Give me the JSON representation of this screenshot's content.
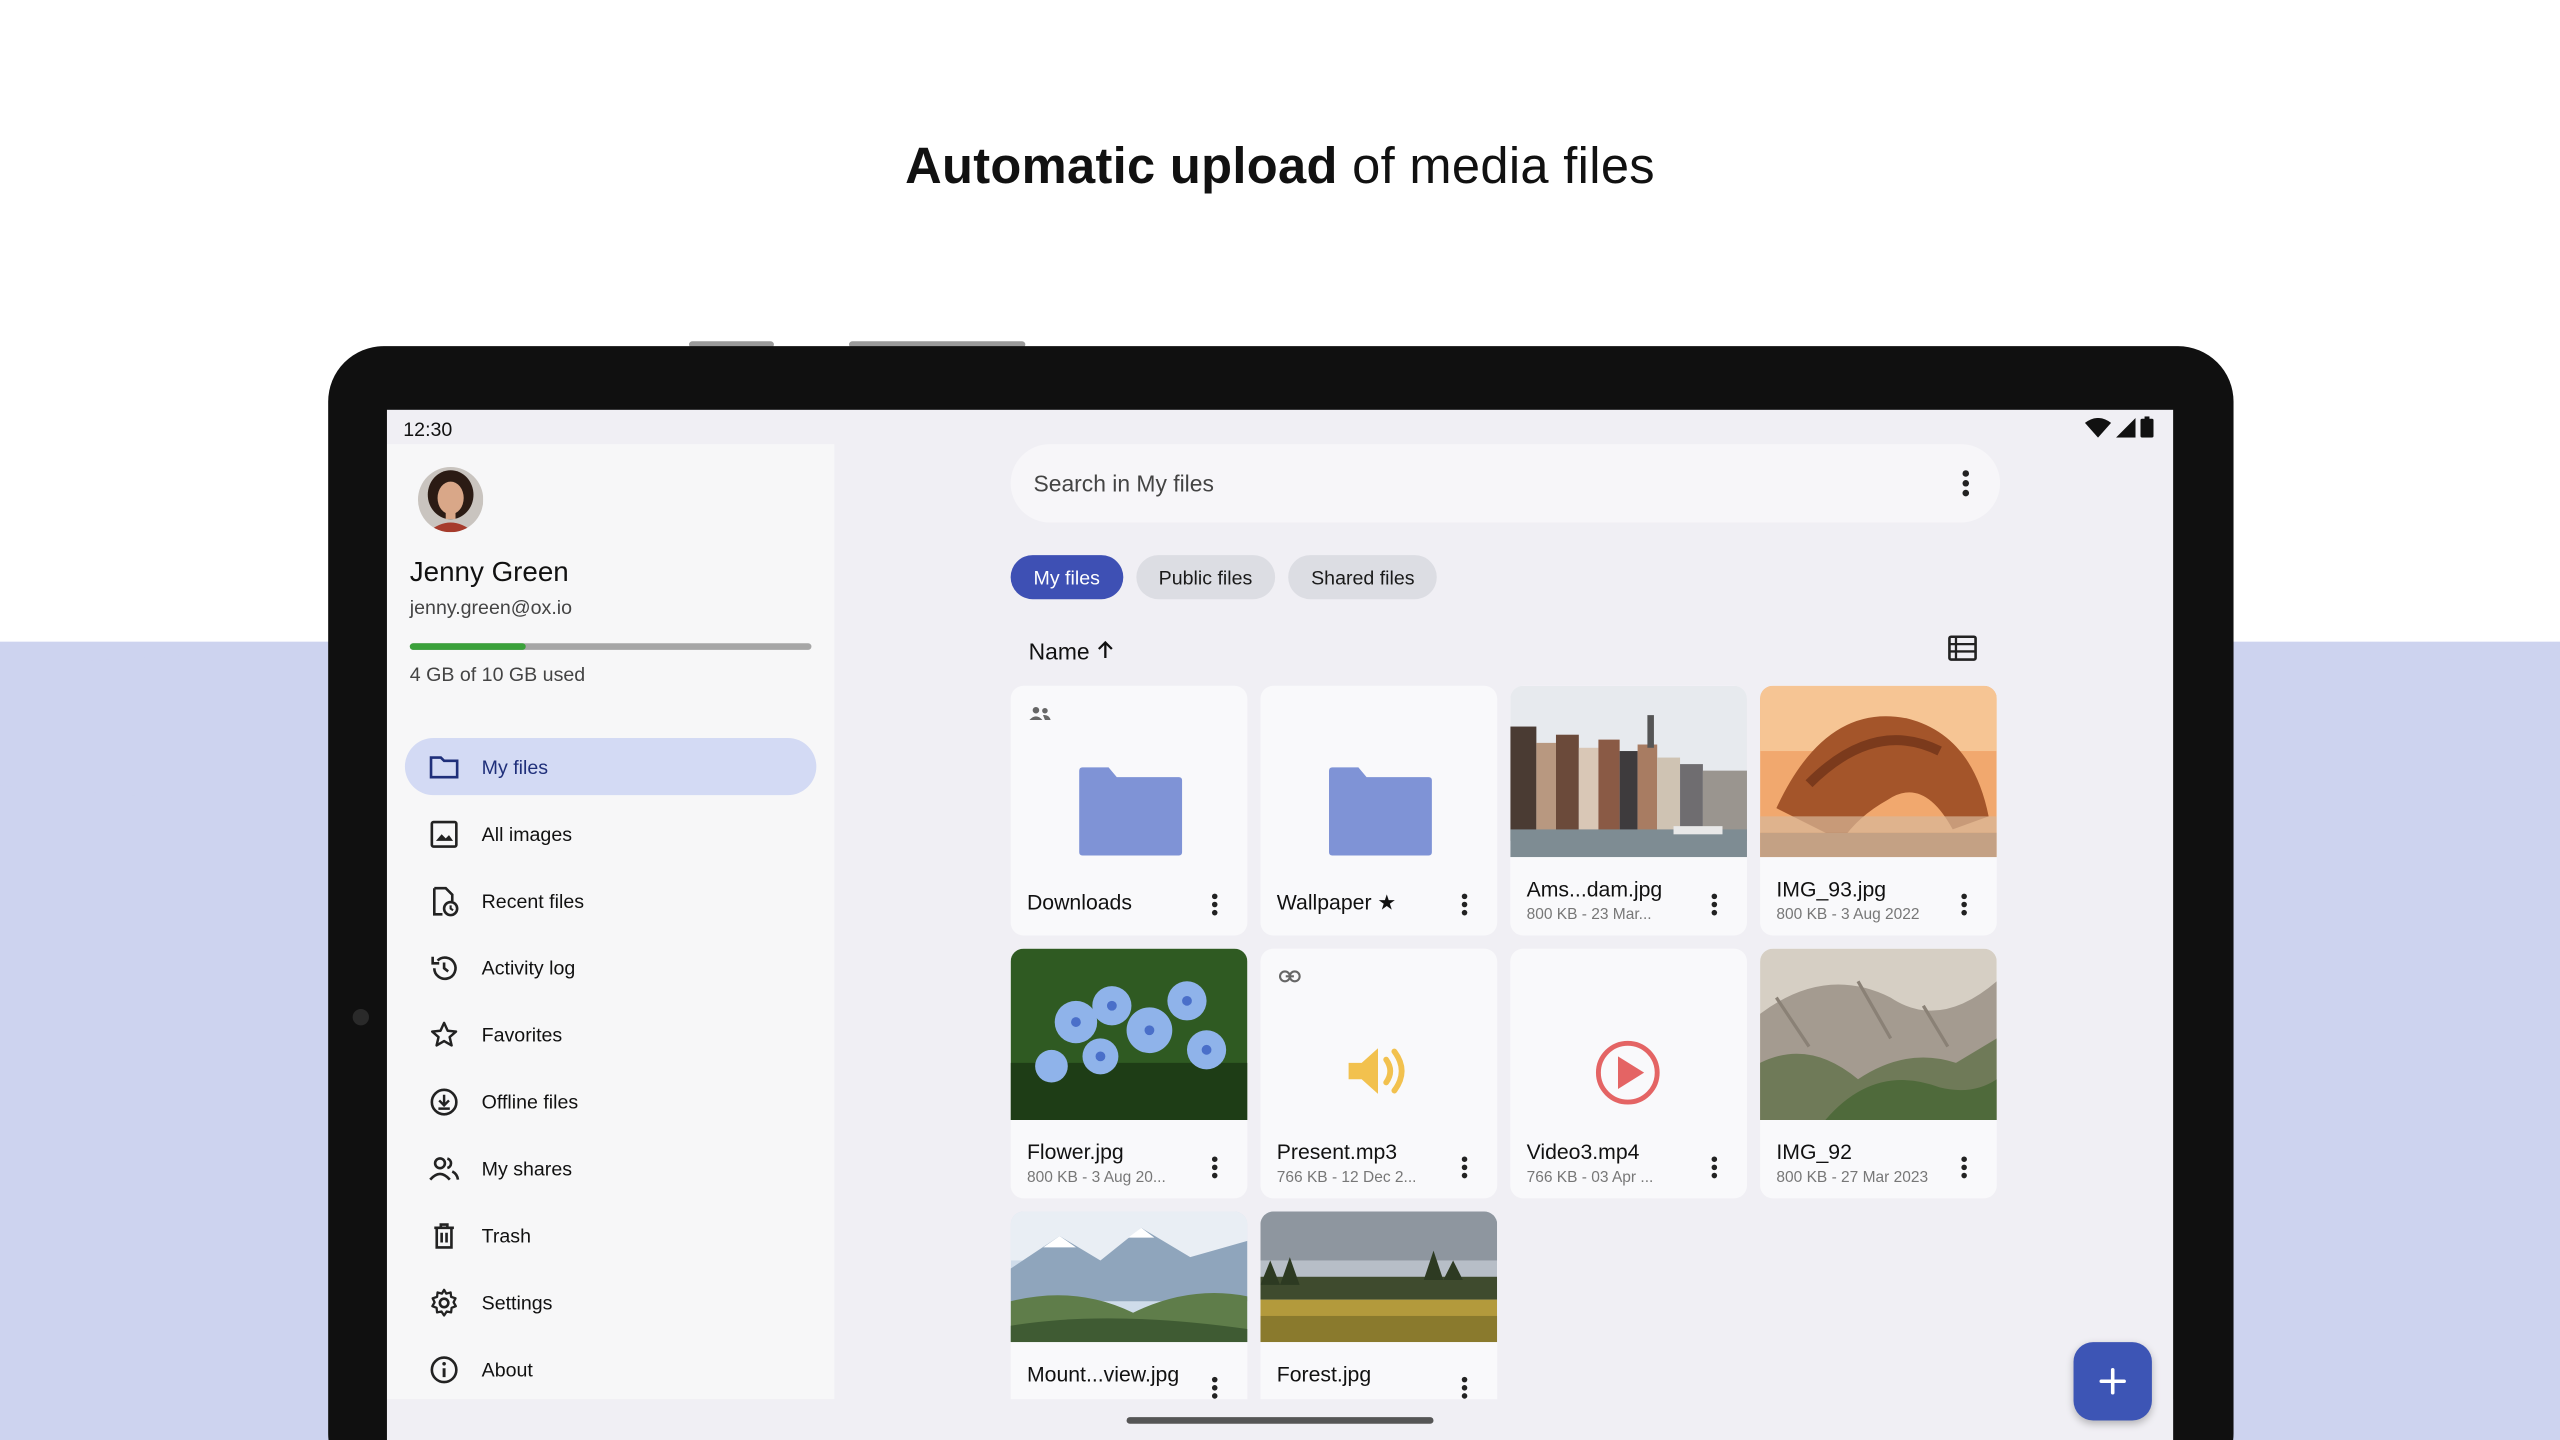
{
  "headline": {
    "bold": "Automatic upload",
    "rest": " of media files"
  },
  "status_bar": {
    "time": "12:30"
  },
  "user": {
    "name": "Jenny Green",
    "email": "jenny.green@ox.io"
  },
  "quota": {
    "text": "4 GB of 10 GB used",
    "used_fraction": 0.29,
    "fill_color": "#3aa13a"
  },
  "nav": [
    {
      "label": "My files",
      "icon": "folder-icon",
      "active": true
    },
    {
      "label": "All images",
      "icon": "image-icon",
      "active": false
    },
    {
      "label": "Recent files",
      "icon": "recent-file-icon",
      "active": false
    },
    {
      "label": "Activity log",
      "icon": "history-icon",
      "active": false
    },
    {
      "label": "Favorites",
      "icon": "star-icon",
      "active": false
    },
    {
      "label": "Offline files",
      "icon": "download-circle-icon",
      "active": false
    },
    {
      "label": "My shares",
      "icon": "people-icon",
      "active": false
    },
    {
      "label": "Trash",
      "icon": "trash-icon",
      "active": false
    },
    {
      "label": "Settings",
      "icon": "gear-icon",
      "active": false
    },
    {
      "label": "About",
      "icon": "info-icon",
      "active": false
    }
  ],
  "search": {
    "placeholder": "Search in My files"
  },
  "tabs": [
    {
      "label": "My files",
      "active": true
    },
    {
      "label": "Public files",
      "active": false
    },
    {
      "label": "Shared files",
      "active": false
    }
  ],
  "sort": {
    "label": "Name",
    "direction": "ascending"
  },
  "files": [
    {
      "title": "Downloads",
      "meta": "",
      "kind": "folder",
      "badge": "shared-people-icon"
    },
    {
      "title": "Wallpaper ★",
      "meta": "",
      "kind": "folder",
      "badge": ""
    },
    {
      "title": "Ams...dam.jpg",
      "meta": "800 KB - 23 Mar...",
      "kind": "image-amsterdam",
      "badge": ""
    },
    {
      "title": "IMG_93.jpg",
      "meta": "800 KB - 3 Aug 2022",
      "kind": "image-rock",
      "badge": ""
    },
    {
      "title": "Flower.jpg",
      "meta": "800 KB - 3 Aug 20...",
      "kind": "image-flower",
      "badge": ""
    },
    {
      "title": "Present.mp3",
      "meta": "766 KB - 12 Dec 2...",
      "kind": "audio",
      "badge": "link-icon"
    },
    {
      "title": "Video3.mp4",
      "meta": "766 KB - 03 Apr ...",
      "kind": "video",
      "badge": ""
    },
    {
      "title": "IMG_92",
      "meta": "800 KB - 27 Mar 2023",
      "kind": "image-mountain-slope",
      "badge": ""
    },
    {
      "title": "Mount...view.jpg",
      "meta": "",
      "kind": "image-valley",
      "badge": ""
    },
    {
      "title": "Forest.jpg",
      "meta": "",
      "kind": "image-forest",
      "badge": ""
    }
  ],
  "colors": {
    "accent": "#3e50b4",
    "folder": "#7f93d6",
    "nav_active": "#d3daf4",
    "audio": "#f2c14e",
    "video": "#e46464"
  }
}
